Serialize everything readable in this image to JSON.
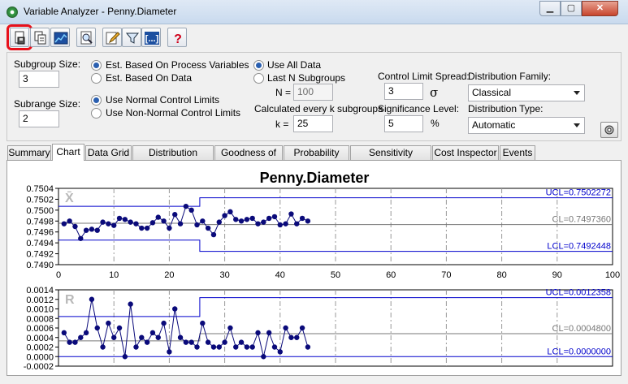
{
  "window": {
    "title": "Variable Analyzer - Penny.Diameter"
  },
  "toolbar": {
    "buttons": [
      "save-report",
      "copy",
      "export-chart",
      "zoom",
      "edit",
      "filter",
      "bracket-settings",
      "help"
    ]
  },
  "settings": {
    "subgroup_size_label": "Subgroup Size:",
    "subgroup_size_value": "3",
    "subrange_size_label": "Subrange Size:",
    "subrange_size_value": "2",
    "est_process_vars": "Est. Based On Process Variables",
    "est_data": "Est. Based On Data",
    "use_normal": "Use Normal Control Limits",
    "use_non_normal": "Use Non-Normal Control Limits",
    "use_all_data": "Use All Data",
    "last_n": "Last N Subgroups",
    "n_label": "N =",
    "n_value": "100",
    "calc_every": "Calculated every k subgroups",
    "k_label": "k =",
    "k_value": "25",
    "cls_label": "Control Limit Spread:",
    "cls_value": "3",
    "sigma": "σ",
    "sig_label": "Significance Level:",
    "sig_value": "5",
    "percent": "%",
    "dist_family_label": "Distribution Family:",
    "dist_family_value": "Classical",
    "dist_type_label": "Distribution Type:",
    "dist_type_value": "Automatic"
  },
  "tabs": [
    {
      "label": "Summary"
    },
    {
      "label": "Chart"
    },
    {
      "label": "Data Grid"
    },
    {
      "label": "Distribution Analysis"
    },
    {
      "label": "Goodness of Fit"
    },
    {
      "label": "Probability Plot"
    },
    {
      "label": "Sensitivity Analysis"
    },
    {
      "label": "Cost Inspector"
    },
    {
      "label": "Events"
    }
  ],
  "chart_data": [
    {
      "type": "line",
      "title": "Penny.Diameter",
      "panel_label": "X̄",
      "x_ticks": [
        "0",
        "10",
        "20",
        "30",
        "40",
        "50",
        "60",
        "70",
        "80",
        "90",
        "100"
      ],
      "y_ticks": [
        "0.7504",
        "0.7502",
        "0.7500",
        "0.7498",
        "0.7496",
        "0.7494",
        "0.7492",
        "0.7490"
      ],
      "ylim": [
        0.749,
        0.7504
      ],
      "xlim": [
        0,
        100
      ],
      "ucl_label": "UCL=0.7502272",
      "cl_label": "CL=0.7497360",
      "lcl_label": "LCL=0.7492448",
      "limits_stage1": {
        "x_end": 25.5,
        "ucl": 0.75007,
        "cl": 0.74976,
        "lcl": 0.74945
      },
      "limits_stage2": {
        "x_start": 25.5,
        "ucl": 0.7502272,
        "cl": 0.749736,
        "lcl": 0.7492448
      },
      "x": [
        1,
        2,
        3,
        4,
        5,
        6,
        7,
        8,
        9,
        10,
        11,
        12,
        13,
        14,
        15,
        16,
        17,
        18,
        19,
        20,
        21,
        22,
        23,
        24,
        25,
        26,
        27,
        28,
        29,
        30,
        31,
        32,
        33,
        34,
        35,
        36,
        37,
        38,
        39,
        40,
        41,
        42,
        43,
        44,
        45
      ],
      "values": [
        0.74975,
        0.7498,
        0.7497,
        0.74948,
        0.74963,
        0.74965,
        0.74963,
        0.74978,
        0.74975,
        0.74972,
        0.74985,
        0.74983,
        0.74978,
        0.74975,
        0.74967,
        0.74967,
        0.74977,
        0.74987,
        0.7498,
        0.74967,
        0.74992,
        0.74975,
        0.75007,
        0.75,
        0.74973,
        0.7498,
        0.74967,
        0.74955,
        0.74978,
        0.7499,
        0.74997,
        0.74983,
        0.7498,
        0.74983,
        0.74985,
        0.74975,
        0.74978,
        0.74985,
        0.74988,
        0.74973,
        0.74975,
        0.74993,
        0.74975,
        0.74985,
        0.7498
      ]
    },
    {
      "type": "line",
      "panel_label": "R",
      "x_ticks": [],
      "y_ticks": [
        "0.0014",
        "0.0012",
        "0.0010",
        "0.0008",
        "0.0006",
        "0.0004",
        "0.0002",
        "0.0000",
        "-0.0002"
      ],
      "ylim": [
        -0.0002,
        0.0014
      ],
      "xlim": [
        0,
        100
      ],
      "ucl_label": "UCL=0.0012358",
      "cl_label": "CL=0.0004800",
      "lcl_label": "LCL=0.0000000",
      "limits_stage1": {
        "x_end": 25.5,
        "ucl": 0.00084,
        "cl": 0.00033,
        "lcl": 0.0
      },
      "limits_stage2": {
        "x_start": 25.5,
        "ucl": 0.0012358,
        "cl": 0.00048,
        "lcl": 0.0
      },
      "x": [
        1,
        2,
        3,
        4,
        5,
        6,
        7,
        8,
        9,
        10,
        11,
        12,
        13,
        14,
        15,
        16,
        17,
        18,
        19,
        20,
        21,
        22,
        23,
        24,
        25,
        26,
        27,
        28,
        29,
        30,
        31,
        32,
        33,
        34,
        35,
        36,
        37,
        38,
        39,
        40,
        41,
        42,
        43,
        44,
        45
      ],
      "values": [
        0.0005,
        0.0003,
        0.0003,
        0.0004,
        0.0005,
        0.0012,
        0.0006,
        0.0002,
        0.0007,
        0.0004,
        0.0006,
        0.0,
        0.0011,
        0.0002,
        0.0004,
        0.0003,
        0.0005,
        0.0004,
        0.0007,
        0.0001,
        0.001,
        0.0004,
        0.0003,
        0.0003,
        0.0002,
        0.0007,
        0.0003,
        0.0002,
        0.0002,
        0.0003,
        0.0006,
        0.0002,
        0.0003,
        0.0002,
        0.0002,
        0.0005,
        0.0,
        0.0005,
        0.0002,
        0.0001,
        0.0006,
        0.0004,
        0.0004,
        0.0006,
        0.0002
      ]
    }
  ],
  "colors": {
    "point": "#0a0a7a",
    "limit": "#0000cc",
    "centerline": "#777777",
    "highlight": "#e8101a"
  }
}
